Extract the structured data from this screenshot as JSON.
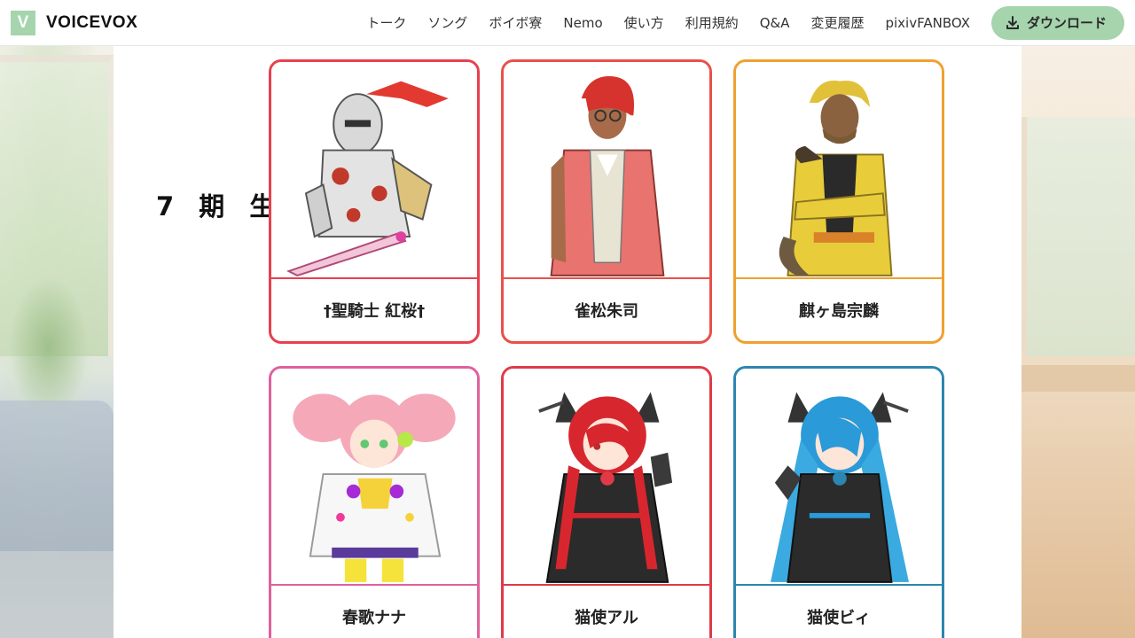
{
  "header": {
    "logo_letter": "V",
    "logo_text": "VOICEVOX",
    "nav": [
      "トーク",
      "ソング",
      "ボイボ寮",
      "Nemo",
      "使い方",
      "利用規約",
      "Q&A",
      "変更履歴",
      "pixivFANBOX"
    ],
    "download_label": "ダウンロード",
    "accent": "#a5d4ad"
  },
  "main": {
    "generation_label": "7 期 生",
    "characters": [
      {
        "name": "†聖騎士 紅桜†",
        "color": "#e8404f"
      },
      {
        "name": "雀松朱司",
        "color": "#e8504a"
      },
      {
        "name": "麒ヶ島宗麟",
        "color": "#f0a030"
      },
      {
        "name": "春歌ナナ",
        "color": "#e0609e"
      },
      {
        "name": "猫使アル",
        "color": "#e03a48"
      },
      {
        "name": "猫使ビィ",
        "color": "#2c86b0"
      }
    ]
  }
}
